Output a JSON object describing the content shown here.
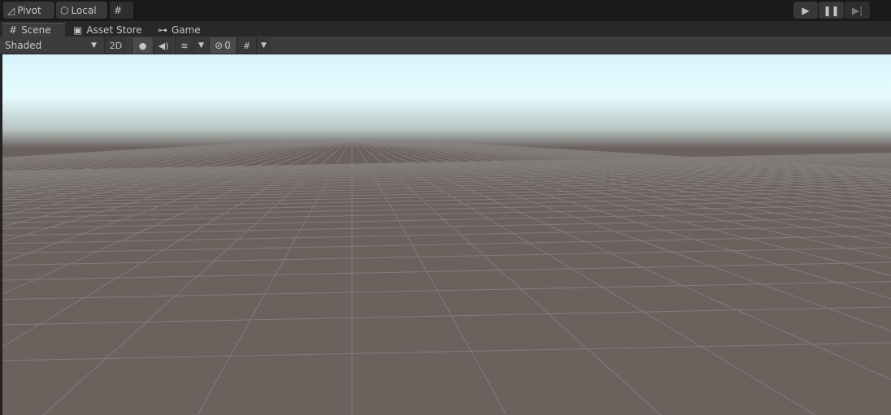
{
  "top_toolbar": {
    "pivot_label": "Pivot",
    "local_label": "Local"
  },
  "tabs": [
    {
      "label": "Scene",
      "icon": "grid-icon"
    },
    {
      "label": "Asset Store",
      "icon": "bag-icon"
    },
    {
      "label": "Game",
      "icon": "gamepad-icon"
    }
  ],
  "scene_toolbar": {
    "shading_mode": "Shaded",
    "mode_2d": "2D",
    "hidden_count": "0"
  },
  "colors": {
    "sky_top": "#e8fbff",
    "ground": "#6b625e",
    "grid_line": "#8a8584"
  }
}
